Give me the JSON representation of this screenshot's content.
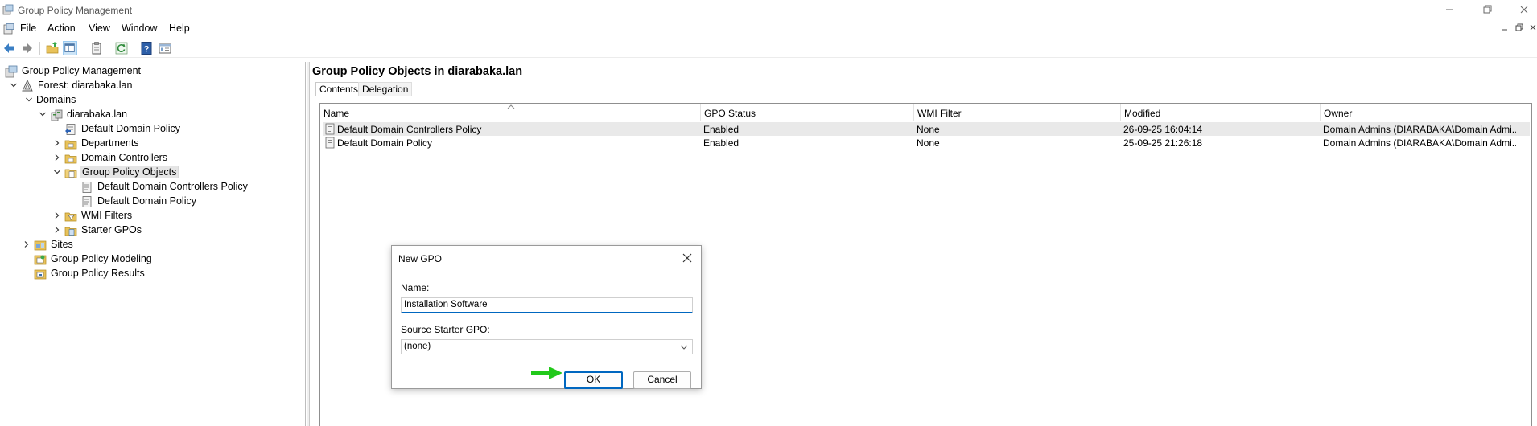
{
  "window": {
    "title": "Group Policy Management",
    "minimize_icon": "minimize-icon",
    "restore_icon": "restore-icon",
    "close_icon": "close-icon"
  },
  "menu": {
    "items": [
      "File",
      "Action",
      "View",
      "Window",
      "Help"
    ]
  },
  "toolbar": {
    "icons": [
      "back-arrow-icon",
      "forward-arrow-icon",
      "up-folder-icon",
      "show-hide-tree-icon",
      "clipboard-icon",
      "refresh-icon",
      "help-icon",
      "properties-icon"
    ]
  },
  "tree": {
    "items": [
      {
        "label": "Group Policy Management",
        "icon": "gpm-root-icon"
      },
      {
        "label": "Forest: diarabaka.lan",
        "icon": "forest-icon"
      },
      {
        "label": "Domains",
        "icon": "folder-icon"
      },
      {
        "label": "diarabaka.lan",
        "icon": "domain-icon"
      },
      {
        "label": "Default Domain Policy",
        "icon": "gpo-link-icon"
      },
      {
        "label": "Departments",
        "icon": "ou-icon"
      },
      {
        "label": "Domain Controllers",
        "icon": "ou-icon"
      },
      {
        "label": "Group Policy Objects",
        "icon": "gpo-folder-icon"
      },
      {
        "label": "Default Domain Controllers Policy",
        "icon": "gpo-icon"
      },
      {
        "label": "Default Domain Policy",
        "icon": "gpo-icon"
      },
      {
        "label": "WMI Filters",
        "icon": "wmi-filter-icon"
      },
      {
        "label": "Starter GPOs",
        "icon": "starter-gpo-icon"
      },
      {
        "label": "Sites",
        "icon": "sites-icon"
      },
      {
        "label": "Group Policy Modeling",
        "icon": "modeling-icon"
      },
      {
        "label": "Group Policy Results",
        "icon": "results-icon"
      }
    ]
  },
  "main": {
    "title": "Group Policy Objects in diarabaka.lan",
    "tabs": [
      "Contents",
      "Delegation"
    ],
    "columns": [
      "Name",
      "GPO Status",
      "WMI Filter",
      "Modified",
      "Owner"
    ],
    "rows": [
      [
        "Default Domain Controllers Policy",
        "Enabled",
        "None",
        "26-09-25 16:04:14",
        "Domain Admins (DIARABAKA\\Domain Admi..."
      ],
      [
        "Default Domain Policy",
        "Enabled",
        "None",
        "25-09-25 21:26:18",
        "Domain Admins (DIARABAKA\\Domain Admi..."
      ]
    ]
  },
  "dialog": {
    "title": "New GPO",
    "name_label": "Name:",
    "name_value": "Installation Software",
    "source_label": "Source Starter GPO:",
    "source_value": "(none)",
    "ok_label": "OK",
    "cancel_label": "Cancel",
    "pointer_color": "#22c91a"
  }
}
